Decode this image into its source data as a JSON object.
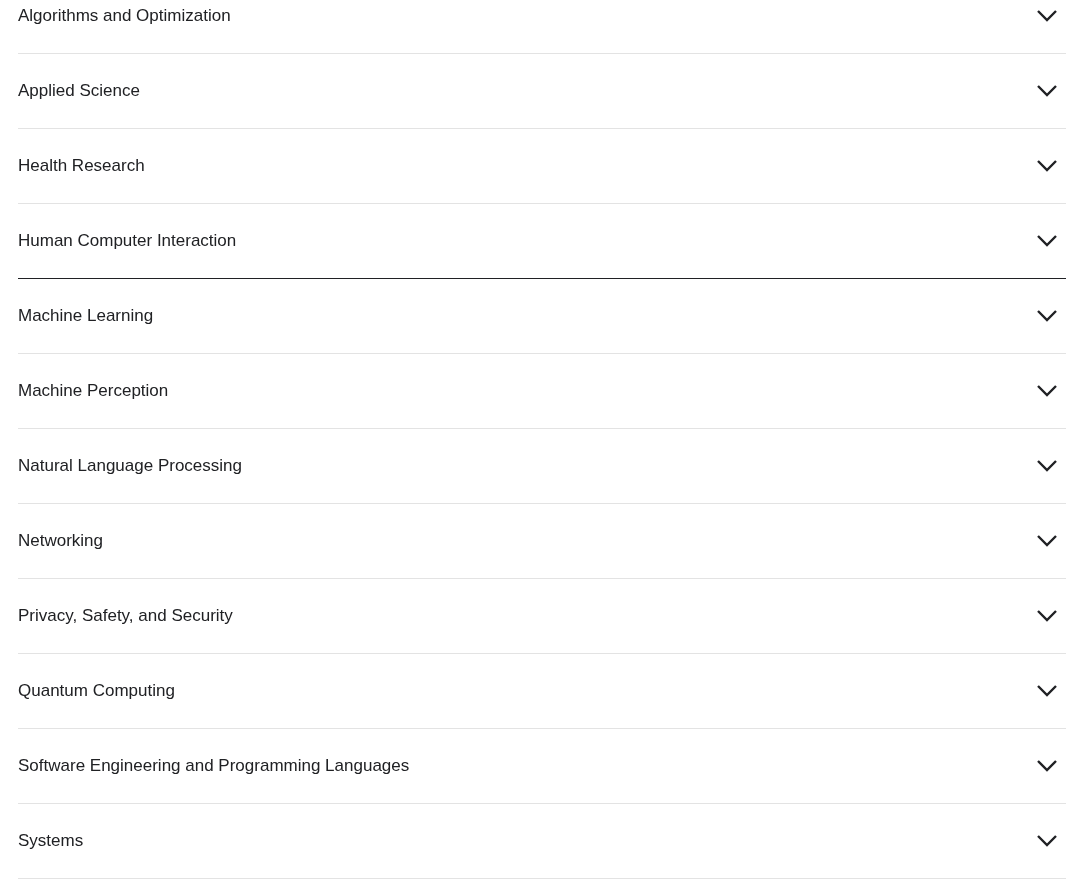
{
  "accordion": {
    "items": [
      {
        "label": "Algorithms and Optimization",
        "expanded": false,
        "highlighted": false
      },
      {
        "label": "Applied Science",
        "expanded": false,
        "highlighted": false
      },
      {
        "label": "Health Research",
        "expanded": false,
        "highlighted": false
      },
      {
        "label": "Human Computer Interaction",
        "expanded": false,
        "highlighted": true
      },
      {
        "label": "Machine Learning",
        "expanded": false,
        "highlighted": false
      },
      {
        "label": "Machine Perception",
        "expanded": false,
        "highlighted": false
      },
      {
        "label": "Natural Language Processing",
        "expanded": false,
        "highlighted": false
      },
      {
        "label": "Networking",
        "expanded": false,
        "highlighted": false
      },
      {
        "label": "Privacy, Safety, and Security",
        "expanded": false,
        "highlighted": false
      },
      {
        "label": "Quantum Computing",
        "expanded": false,
        "highlighted": false
      },
      {
        "label": "Software Engineering and Programming Languages",
        "expanded": false,
        "highlighted": false
      },
      {
        "label": "Systems",
        "expanded": false,
        "highlighted": false
      }
    ]
  }
}
